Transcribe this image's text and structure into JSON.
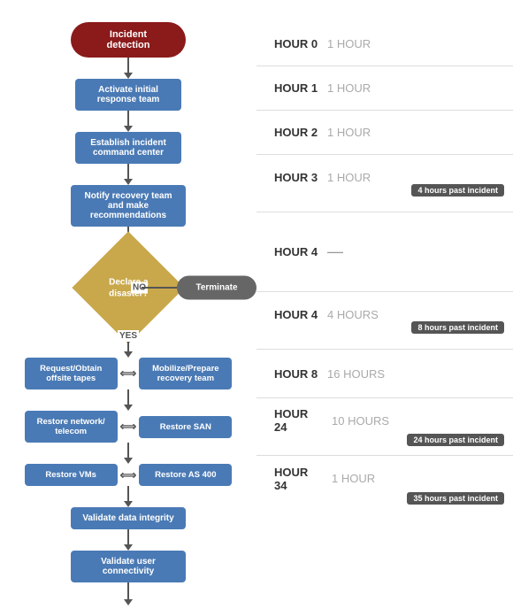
{
  "flow": {
    "nodes": [
      {
        "id": "incident",
        "type": "oval",
        "label": "Incident detection"
      },
      {
        "id": "activate",
        "type": "rect",
        "label": "Activate initial response team"
      },
      {
        "id": "establish",
        "type": "rect",
        "label": "Establish incident command center"
      },
      {
        "id": "notify",
        "type": "rect",
        "label": "Notify recovery team and make recommendations"
      },
      {
        "id": "declare",
        "type": "diamond",
        "label": "Declare a disaster?"
      },
      {
        "id": "terminate",
        "type": "terminate",
        "label": "Terminate"
      },
      {
        "id": "no_label",
        "label": "NO"
      },
      {
        "id": "yes_label",
        "label": "YES"
      },
      {
        "id": "request",
        "type": "rect",
        "label": "Request/Obtain offsite tapes"
      },
      {
        "id": "mobilize",
        "type": "rect",
        "label": "Mobilize/Prepare recovery team"
      },
      {
        "id": "restore_net",
        "type": "rect",
        "label": "Restore network/ telecom"
      },
      {
        "id": "restore_san",
        "type": "rect",
        "label": "Restore SAN"
      },
      {
        "id": "restore_vms",
        "type": "rect",
        "label": "Restore VMs"
      },
      {
        "id": "restore_as400",
        "type": "rect",
        "label": "Restore AS 400"
      },
      {
        "id": "validate_data",
        "type": "rect",
        "label": "Validate data integrity"
      },
      {
        "id": "validate_user",
        "type": "rect",
        "label": "Validate user connectivity"
      }
    ]
  },
  "timeline": {
    "rows": [
      {
        "hour": "HOUR 0",
        "duration": "1 HOUR",
        "badge": null
      },
      {
        "hour": "HOUR 1",
        "duration": "1 HOUR",
        "badge": null
      },
      {
        "hour": "HOUR 2",
        "duration": "1 HOUR",
        "badge": null
      },
      {
        "hour": "HOUR 3",
        "duration": "1 HOUR",
        "badge": "4 hours past incident"
      },
      {
        "hour": "HOUR 4",
        "duration": "—",
        "badge": null,
        "dash": true
      },
      {
        "hour": "HOUR 4",
        "duration": "4 HOURS",
        "badge": "8 hours past incident"
      },
      {
        "hour": "HOUR 8",
        "duration": "16 HOURS",
        "badge": null
      },
      {
        "hour": "HOUR 24",
        "duration": "10 HOURS",
        "badge": "24 hours past incident"
      },
      {
        "hour": "HOUR 34",
        "duration": "1 HOUR",
        "badge": "35 hours past incident"
      }
    ]
  }
}
